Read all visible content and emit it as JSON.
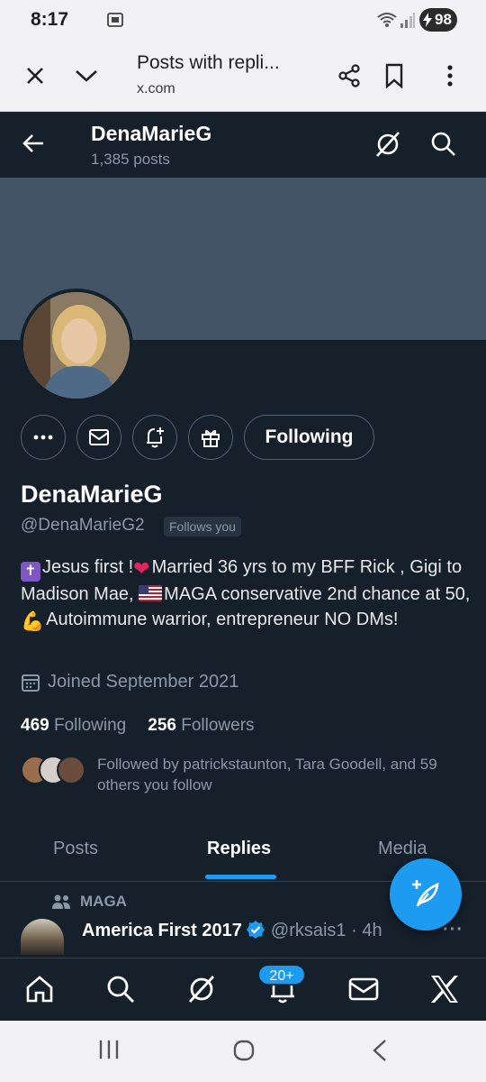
{
  "status_bar": {
    "time": "8:17",
    "battery": "98"
  },
  "browser": {
    "title": "Posts with repli...",
    "url": "x.com"
  },
  "nav": {
    "display_name": "DenaMarieG",
    "post_count": "1,385 posts"
  },
  "profile": {
    "name": "DenaMarieG",
    "handle": "@DenaMarieG2",
    "follows_you": "Follows you",
    "following_button": "Following",
    "bio_parts": [
      "Jesus first !",
      "Married 36 yrs to my BFF Rick , Gigi to Madison Mae, ",
      "MAGA conservative  2nd chance at 50,",
      "Autoimmune warrior, entrepreneur NO DMs!"
    ],
    "joined": "Joined September 2021",
    "following_count": "469",
    "following_label": "Following",
    "followers_count": "256",
    "followers_label": "Followers",
    "followed_by": "Followed by patrickstaunton, Tara Goodell, and 59 others you follow"
  },
  "tabs": [
    {
      "label": "Posts",
      "active": false
    },
    {
      "label": "Replies",
      "active": true
    },
    {
      "label": "Media",
      "active": false
    }
  ],
  "post": {
    "context": "MAGA",
    "account_name": "America First 2017",
    "handle": "@rksais1",
    "time": "4h",
    "separator": "·"
  },
  "bottom_nav": {
    "notification_badge": "20+"
  },
  "colors": {
    "background": "#15202b",
    "banner": "#425466",
    "accent": "#1d9bf0",
    "muted": "#8b98a5"
  }
}
